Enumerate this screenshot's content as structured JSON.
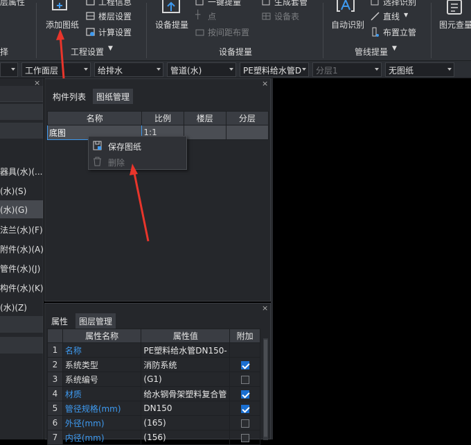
{
  "ribbon": {
    "add_drawing": "添加图纸",
    "project_info": "工程信息",
    "floor_settings": "楼层设置",
    "calc_settings": "计算设置",
    "project_settings_group": "工程设置",
    "device_extract": "设备提量",
    "one_key_extract": "一键提量",
    "point": "点",
    "spacing_layout": "按间距布置",
    "generate_set": "生成套管",
    "device_table": "设备表",
    "device_extract_group": "设备提量",
    "auto_identify": "自动识别",
    "select_identify": "选择识别",
    "straight_line": "直线",
    "vertical_pipe": "布置立管",
    "pipeline_extract_group": "管线提量",
    "element_query": "图元查量",
    "cut_left_1": "层属性",
    "cut_left_2": "择"
  },
  "toolbar": {
    "dd0": "",
    "work_plane": "工作面层",
    "discipline": "给排水",
    "element_type": "管道(水)",
    "pipe_spec": "PE塑料给水管D",
    "sublayer": "分层1",
    "drawing": "无图纸"
  },
  "left_tree": {
    "items": [
      "器具(水)(...",
      "(水)(S)",
      "(水)(G)",
      "法兰(水)(F)",
      "附件(水)(A)",
      "管件(水)(J)",
      "构件(水)(K)",
      "(水)(Z)"
    ]
  },
  "component_panel": {
    "tabs": [
      "构件列表",
      "图纸管理"
    ],
    "columns": [
      "名称",
      "比例",
      "楼层",
      "分层"
    ],
    "rows": [
      {
        "name": "底图",
        "scale": "1:1",
        "floor": "",
        "sublayer": ""
      }
    ],
    "close": "×"
  },
  "context_menu": {
    "save_drawing": "保存图纸",
    "delete": "删除"
  },
  "property_panel": {
    "tabs": [
      "属性",
      "图层管理"
    ],
    "columns": [
      "属性名称",
      "属性值",
      "附加"
    ],
    "rows": [
      {
        "no": "1",
        "name": "名称",
        "value": "PE塑料给水管DN150-",
        "checked": null,
        "blue": true
      },
      {
        "no": "2",
        "name": "系统类型",
        "value": "消防系统",
        "checked": true,
        "blue": false
      },
      {
        "no": "3",
        "name": "系统编号",
        "value": "(G1)",
        "checked": false,
        "blue": false
      },
      {
        "no": "4",
        "name": "材质",
        "value": "给水钢骨架塑料复合管",
        "checked": true,
        "blue": true
      },
      {
        "no": "5",
        "name": "管径规格(mm)",
        "value": "DN150",
        "checked": true,
        "blue": true
      },
      {
        "no": "6",
        "name": "外径(mm)",
        "value": "(165)",
        "checked": false,
        "blue": true
      },
      {
        "no": "7",
        "name": "内径(mm)",
        "value": "(156)",
        "checked": false,
        "blue": true
      }
    ],
    "close": "×"
  },
  "colors": {
    "accent_blue": "#3e9af0",
    "annotation_arrow": "#e8352b",
    "panel_bg": "#25272b",
    "ribbon_bg": "#2f3237"
  }
}
